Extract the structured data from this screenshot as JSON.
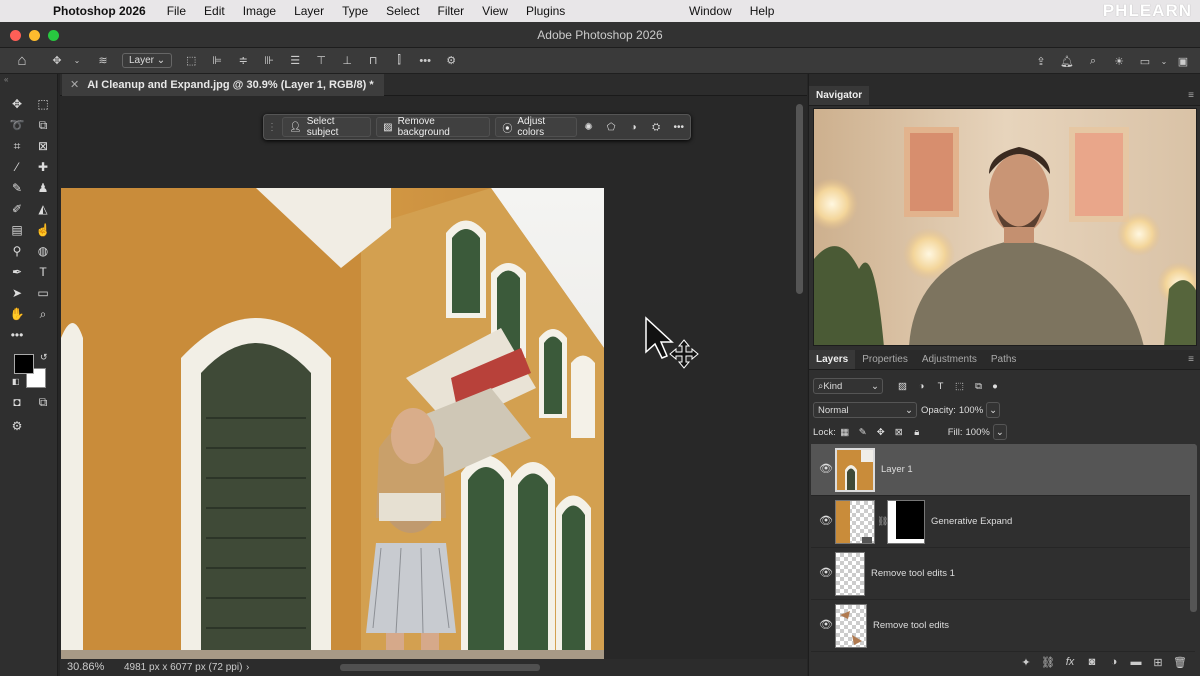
{
  "menubar": {
    "app_name": "Photoshop 2026",
    "items": [
      "File",
      "Edit",
      "Image",
      "Layer",
      "Type",
      "Select",
      "Filter",
      "View",
      "Plugins"
    ],
    "right_items": [
      "Window",
      "Help"
    ],
    "watermark": "PHLEARN"
  },
  "window": {
    "title": "Adobe Photoshop 2026"
  },
  "options_bar": {
    "layer_select": "Layer"
  },
  "document_tab": {
    "label": "AI Cleanup and Expand.jpg @ 30.9% (Layer 1, RGB/8) *"
  },
  "contextual_taskbar": {
    "select_subject": "Select subject",
    "remove_background": "Remove background",
    "adjust_colors": "Adjust colors"
  },
  "status_bar": {
    "zoom": "30.86%",
    "doc_info": "4981 px x 6077 px (72 ppi)"
  },
  "navigator": {
    "tab": "Navigator"
  },
  "layers_panel": {
    "tabs": [
      "Layers",
      "Properties",
      "Adjustments",
      "Paths"
    ],
    "active_tab": "Layers",
    "filter_kind": "Kind",
    "blend_mode": "Normal",
    "opacity_label": "Opacity:",
    "opacity_value": "100%",
    "lock_label": "Lock:",
    "fill_label": "Fill:",
    "fill_value": "100%",
    "layers": [
      {
        "name": "Layer 1",
        "selected": true
      },
      {
        "name": "Generative Expand",
        "selected": false
      },
      {
        "name": "Remove tool edits 1",
        "selected": false
      },
      {
        "name": "Remove tool edits",
        "selected": false
      }
    ]
  },
  "colors": {
    "accent": "#2b5aa8",
    "panel": "#2f2f2f",
    "canvas": "#282828"
  }
}
